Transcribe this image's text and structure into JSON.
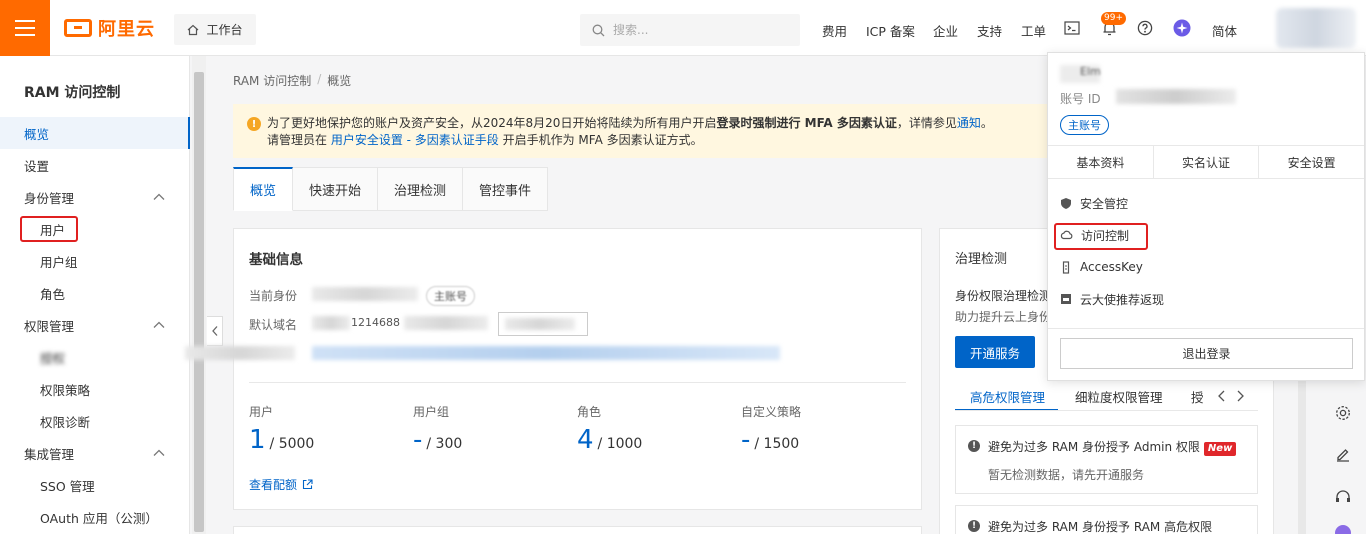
{
  "brand": {
    "logo_text": "阿里云",
    "accent": "#ff6a00",
    "link_blue": "#0064c8"
  },
  "topbar": {
    "workbench": "工作台",
    "search_placeholder": "搜索...",
    "nav": [
      "费用",
      "ICP 备案",
      "企业",
      "支持",
      "工单"
    ],
    "notification_badge": "99+",
    "language": "简体"
  },
  "sidebar": {
    "title": "RAM 访问控制",
    "items": [
      {
        "label": "概览",
        "active": true
      },
      {
        "label": "设置"
      },
      {
        "label": "身份管理",
        "group": true
      },
      {
        "label": "用户",
        "highlighted": true
      },
      {
        "label": "用户组"
      },
      {
        "label": "角色"
      },
      {
        "label": "权限管理",
        "group": true
      },
      {
        "label": "授权"
      },
      {
        "label": "权限策略"
      },
      {
        "label": "权限诊断"
      },
      {
        "label": "集成管理",
        "group": true
      },
      {
        "label": "SSO 管理"
      },
      {
        "label": "OAuth 应用（公测）"
      }
    ]
  },
  "breadcrumb": [
    "RAM 访问控制",
    "/",
    "概览"
  ],
  "notice": {
    "line1_a": "为了更好地保护您的账户及资产安全，从2024年8月20日开始将陆续为所有用户开启",
    "line1_bold": "登录时强制进行 MFA 多因素认证",
    "line1_b": "，详情参见",
    "line1_link": "通知",
    "line1_end": "。",
    "line2_a": "请管理员在 ",
    "line2_link": "用户安全设置 - 多因素认证手段",
    "line2_b": " 开启手机作为 MFA 多因素认证方式。"
  },
  "tabs": [
    "概览",
    "快速开始",
    "治理检测",
    "管控事件"
  ],
  "basic_info": {
    "title": "基础信息",
    "identity_label": "当前身份",
    "identity_tag": "主账号",
    "domain_label": "默认域名",
    "domain_partial": "1214688"
  },
  "stats": [
    {
      "label": "用户",
      "value": "1",
      "limit": "/ 5000"
    },
    {
      "label": "用户组",
      "value": "-",
      "limit": "/ 300"
    },
    {
      "label": "角色",
      "value": "4",
      "limit": "/ 1000"
    },
    {
      "label": "自定义策略",
      "value": "-",
      "limit": "/ 1500"
    }
  ],
  "quota_link": "查看配额",
  "governance": {
    "title": "治理检测",
    "desc1": "身份权限治理检测",
    "desc2": "助力提升云上身份",
    "open_button": "开通服务",
    "sub_tabs": [
      "高危权限管理",
      "细粒度权限管理",
      "授"
    ],
    "risk1_title": "避免为过多 RAM 身份授予 Admin 权限",
    "risk1_tag": "New",
    "risk1_desc": "暂无检测数据，请先开通服务",
    "risk2_title": "避免为过多 RAM 身份授予 RAM 高危权限"
  },
  "dropdown": {
    "name_partial": "Elm",
    "account_id_label": "账号 ID",
    "main_account": "主账号",
    "tabs": [
      "基本资料",
      "实名认证",
      "安全设置"
    ],
    "items": [
      {
        "label": "安全管控",
        "icon": "shield-icon"
      },
      {
        "label": "访问控制",
        "icon": "cloud-key-icon",
        "highlighted": true
      },
      {
        "label": "AccessKey",
        "icon": "key-icon"
      },
      {
        "label": "云大使推荐返现",
        "icon": "gift-icon"
      }
    ],
    "logout": "退出登录"
  }
}
